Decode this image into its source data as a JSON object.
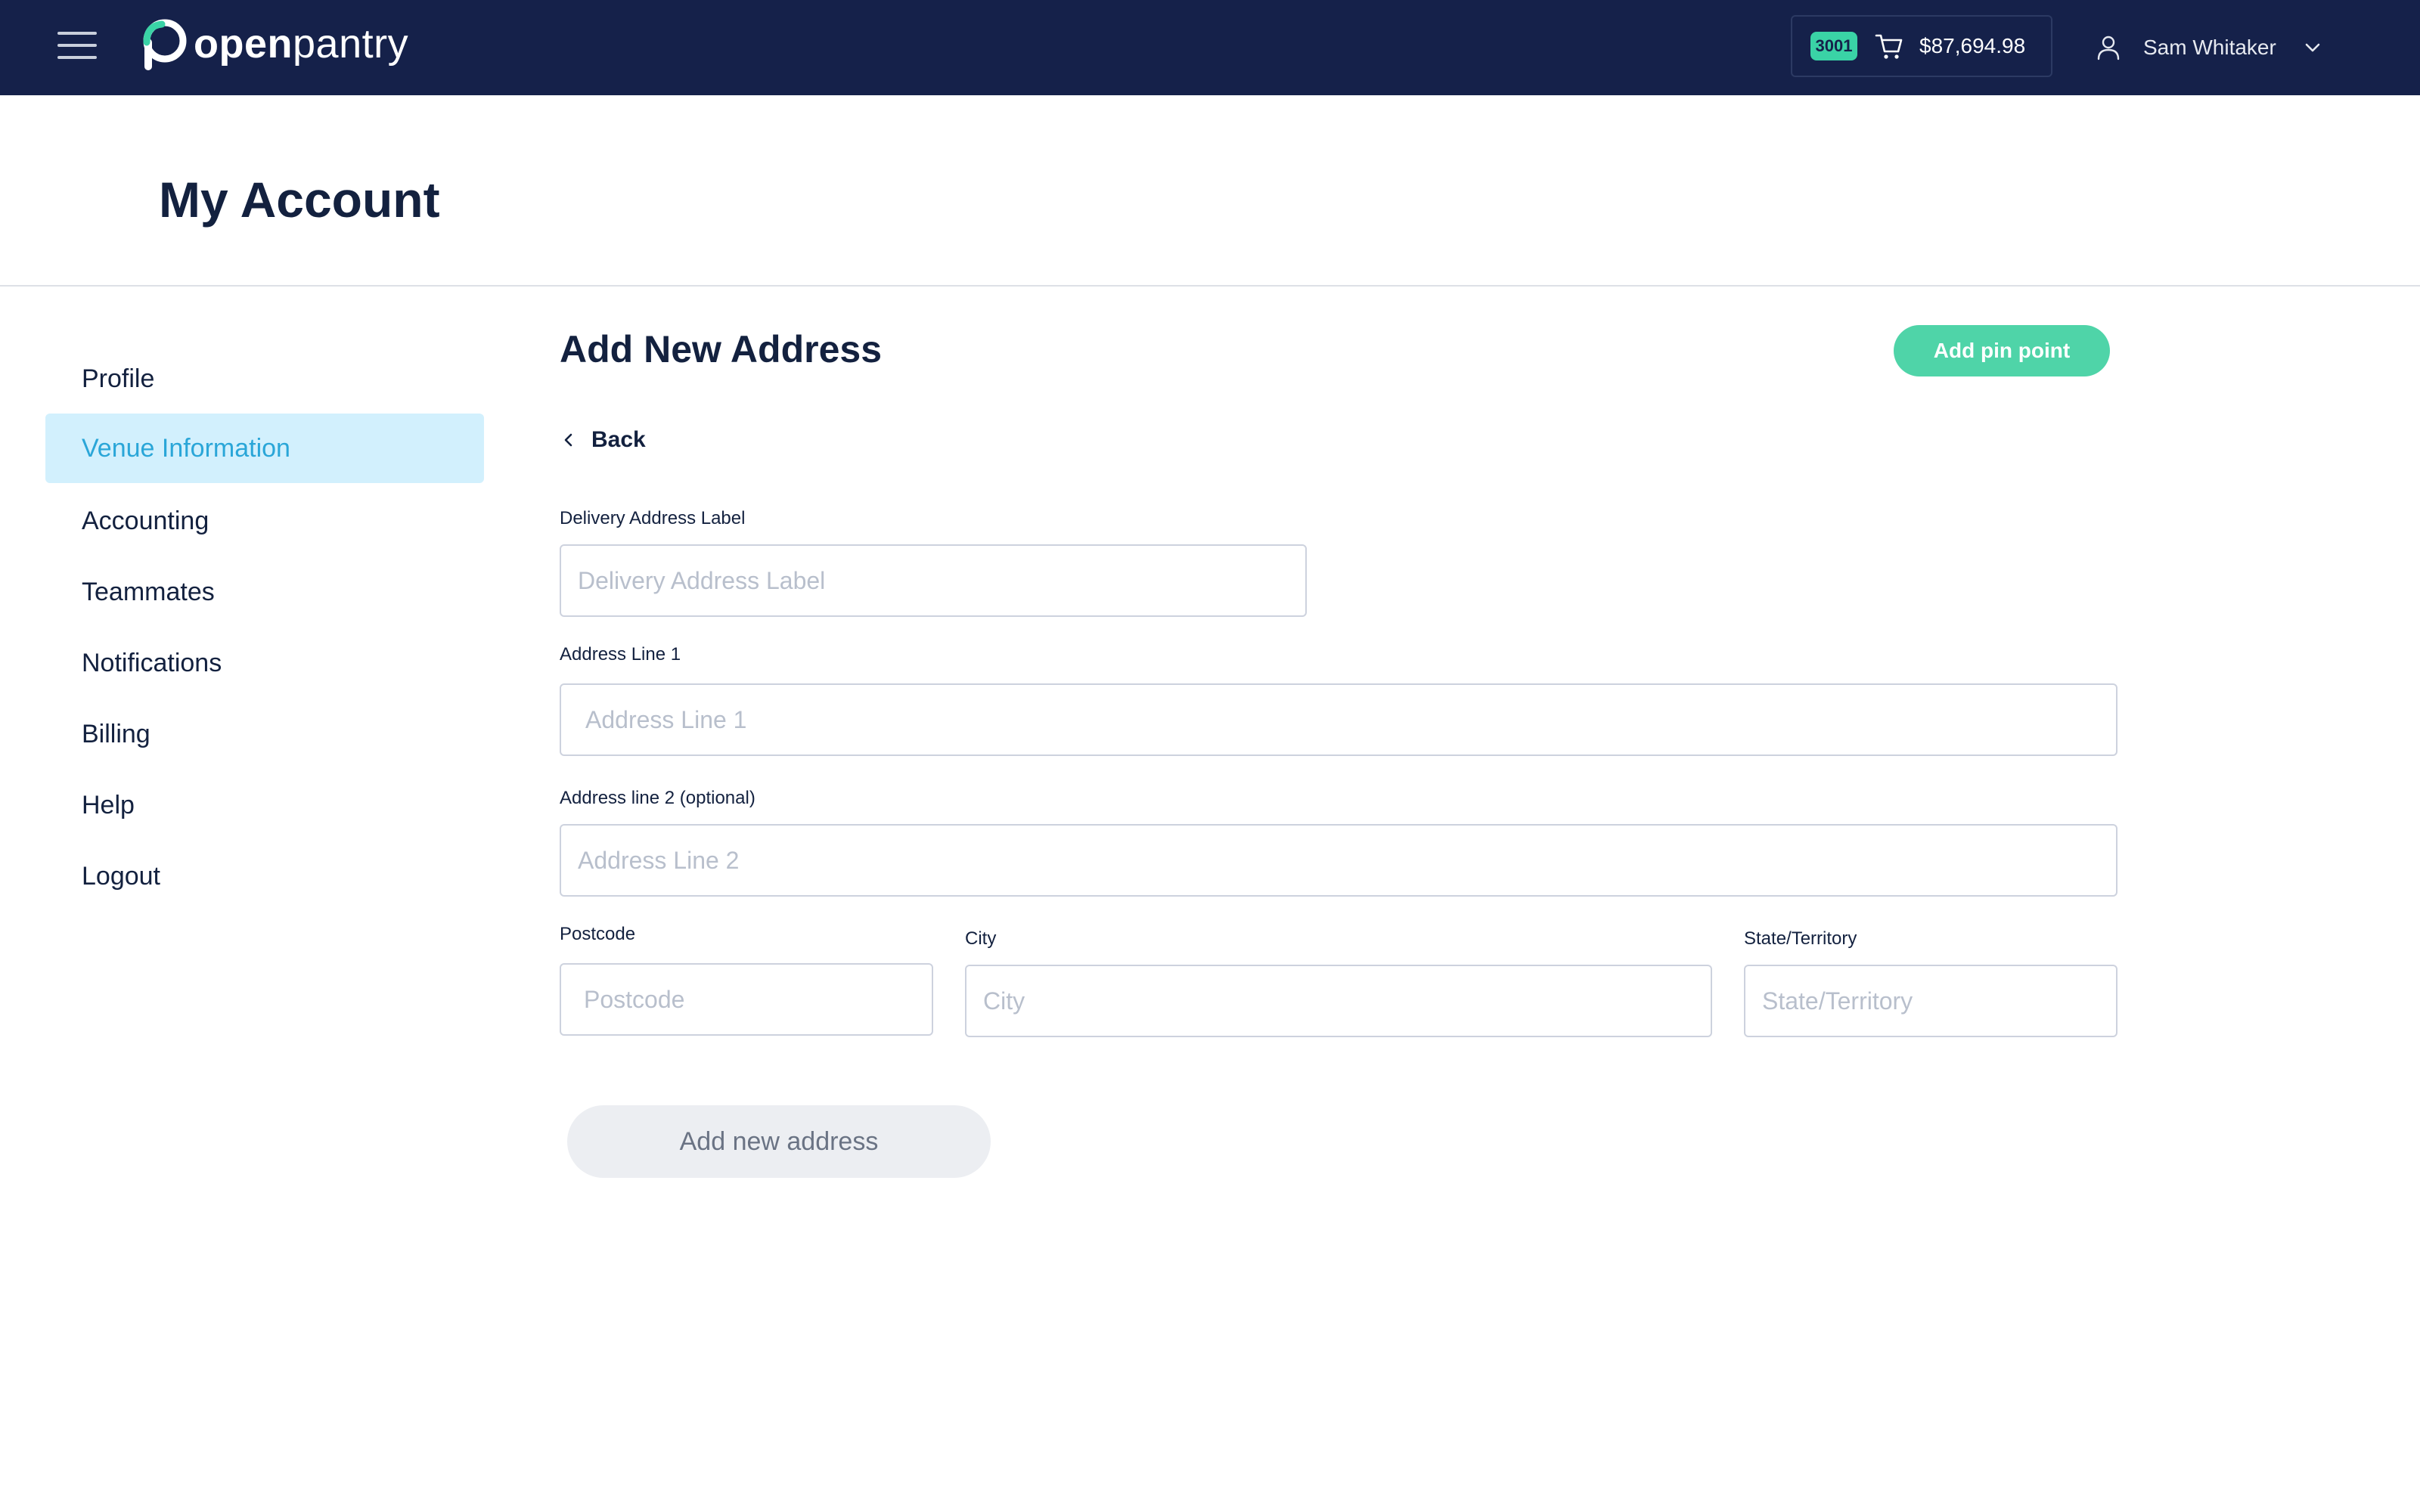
{
  "header": {
    "logo_bold": "open",
    "logo_light": "pantry",
    "cart_badge": "3001",
    "cart_total": "$87,694.98",
    "user_name": "Sam Whitaker",
    "icons": {
      "menu": "hamburger-icon",
      "cart": "cart-icon",
      "user": "user-icon",
      "dropdown": "chevron-down-icon"
    },
    "colors": {
      "background": "#15214a",
      "badge": "#3ad3a6"
    }
  },
  "page": {
    "title": "My Account"
  },
  "sidebar": {
    "items": [
      {
        "label": "Profile",
        "active": false
      },
      {
        "label": "Venue Information",
        "active": true
      },
      {
        "label": "Accounting",
        "active": false
      },
      {
        "label": "Teammates",
        "active": false
      },
      {
        "label": "Notifications",
        "active": false
      },
      {
        "label": "Billing",
        "active": false
      },
      {
        "label": "Help",
        "active": false
      },
      {
        "label": "Logout",
        "active": false
      }
    ],
    "colors": {
      "active_bg": "#d2f0fd",
      "active_text": "#2aa6d8"
    }
  },
  "form": {
    "title": "Add New Address",
    "pin_button": "Add pin point",
    "back_label": "Back",
    "fields": {
      "delivery_label": {
        "label": "Delivery Address Label",
        "placeholder": "Delivery Address Label",
        "value": ""
      },
      "address_line1": {
        "label": "Address Line 1",
        "placeholder": "Address Line 1",
        "value": ""
      },
      "address_line2": {
        "label": "Address line 2 (optional)",
        "placeholder": "Address Line 2",
        "value": ""
      },
      "postcode": {
        "label": "Postcode",
        "placeholder": "Postcode",
        "value": ""
      },
      "city": {
        "label": "City",
        "placeholder": "City",
        "value": ""
      },
      "state": {
        "label": "State/Territory",
        "placeholder": "State/Territory",
        "value": ""
      }
    },
    "submit_label": "Add new address",
    "colors": {
      "pin_button": "#4fd4a8",
      "submit_bg": "#eceef2"
    }
  }
}
